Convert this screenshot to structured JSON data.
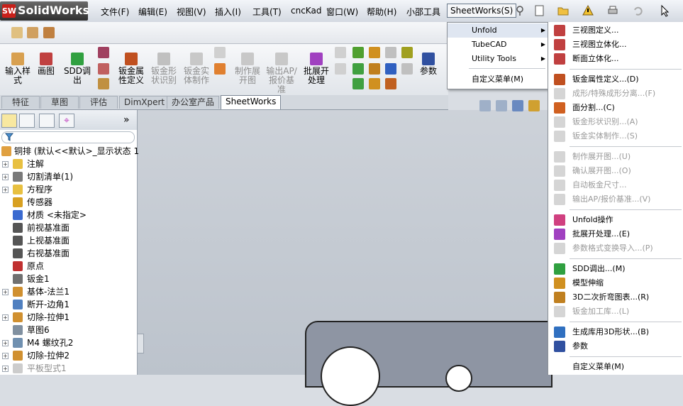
{
  "app": {
    "logo_text": "SolidWorks",
    "logo_badge": "SW"
  },
  "menubar": {
    "items": [
      "文件(F)",
      "编辑(E)",
      "视图(V)",
      "插入(I)",
      "工具(T)",
      "cncKad",
      "窗口(W)",
      "帮助(H)",
      "小邵工具",
      "SheetWorks(S)"
    ]
  },
  "command_manager": {
    "buttons": [
      {
        "label": "输入样\n式",
        "enabled": true
      },
      {
        "label": "画图",
        "enabled": true
      },
      {
        "label": "SDD调出",
        "enabled": true
      },
      {
        "label": "钣金属\n性定义",
        "enabled": true
      },
      {
        "label": "钣金形\n状识别",
        "enabled": false
      },
      {
        "label": "钣金实\n体制作",
        "enabled": false
      },
      {
        "label": "制作展\n开图",
        "enabled": false
      },
      {
        "label": "输出AP/\n报价基\n准",
        "enabled": false
      },
      {
        "label": "批展开\n处理",
        "enabled": true
      },
      {
        "label": "参数",
        "enabled": true
      }
    ]
  },
  "tabs": [
    {
      "label": "特征",
      "active": false
    },
    {
      "label": "草图",
      "active": false
    },
    {
      "label": "评估",
      "active": false
    },
    {
      "label": "DimXpert",
      "active": false
    },
    {
      "label": "办公室产品",
      "active": false
    },
    {
      "label": "SheetWorks",
      "active": true
    }
  ],
  "tree": {
    "root": "铜排 (默认<<默认>_显示状态 1",
    "items": [
      {
        "label": "注解",
        "expand": true,
        "icon": "annotation-icon",
        "color": "#e8c040"
      },
      {
        "label": "切割清单(1)",
        "expand": true,
        "icon": "cut-list-icon",
        "color": "#7a7a7a"
      },
      {
        "label": "方程序",
        "expand": true,
        "icon": "equation-icon",
        "color": "#e8c040"
      },
      {
        "label": "传感器",
        "expand": false,
        "icon": "sensor-icon",
        "color": "#d8a020"
      },
      {
        "label": "材质 <未指定>",
        "expand": false,
        "icon": "material-icon",
        "color": "#3a6ad0"
      },
      {
        "label": "前视基准面",
        "expand": false,
        "icon": "plane-icon",
        "color": "#555"
      },
      {
        "label": "上视基准面",
        "expand": false,
        "icon": "plane-icon",
        "color": "#555"
      },
      {
        "label": "右视基准面",
        "expand": false,
        "icon": "plane-icon",
        "color": "#555"
      },
      {
        "label": "原点",
        "expand": false,
        "icon": "origin-icon",
        "color": "#c03030"
      },
      {
        "label": "钣金1",
        "expand": false,
        "icon": "sheet-metal-icon",
        "color": "#707070"
      },
      {
        "label": "基体-法兰1",
        "expand": true,
        "icon": "base-flange-icon",
        "color": "#d09030"
      },
      {
        "label": "断开-边角1",
        "expand": false,
        "icon": "break-corner-icon",
        "color": "#5080c0"
      },
      {
        "label": "切除-拉伸1",
        "expand": true,
        "icon": "cut-extrude-icon",
        "color": "#d09030"
      },
      {
        "label": "草图6",
        "expand": false,
        "icon": "sketch-icon",
        "color": "#8090a0"
      },
      {
        "label": "M4 螺纹孔2",
        "expand": true,
        "icon": "hole-icon",
        "color": "#7090b0"
      },
      {
        "label": "切除-拉伸2",
        "expand": true,
        "icon": "cut-extrude-icon",
        "color": "#d09030"
      },
      {
        "label": "平板型式1",
        "expand": true,
        "icon": "flat-pattern-icon",
        "color": "#999",
        "disabled": true
      }
    ]
  },
  "submenu": {
    "items": [
      {
        "label": "Unfold",
        "arrow": true,
        "highlighted": true
      },
      {
        "label": "TubeCAD",
        "arrow": true
      },
      {
        "label": "Utility Tools",
        "arrow": true
      },
      {
        "label": "自定义菜单(M)",
        "arrow": false
      }
    ]
  },
  "mainmenu": {
    "items": [
      {
        "label": "三视图定义...",
        "enabled": true,
        "icon": "three-view-icon",
        "color": "#c04040"
      },
      {
        "label": "三视图立体化...",
        "enabled": true,
        "icon": "three-view-solid-icon",
        "color": "#c04040"
      },
      {
        "label": "断面立体化...",
        "enabled": true,
        "icon": "section-solid-icon",
        "color": "#c04040"
      },
      {
        "sep": true
      },
      {
        "label": "钣金属性定义...(D)",
        "enabled": true,
        "icon": "sheet-property-icon",
        "color": "#c05020"
      },
      {
        "label": "成形/特殊成形分离...(F)",
        "enabled": false,
        "icon": "form-split-icon",
        "color": "#888"
      },
      {
        "label": "面分割...(C)",
        "enabled": true,
        "icon": "face-split-icon",
        "color": "#d06020"
      },
      {
        "label": "钣金形状识别...(A)",
        "enabled": false,
        "icon": "shape-recognize-icon",
        "color": "#888"
      },
      {
        "label": "钣金实体制作...(S)",
        "enabled": false,
        "icon": "solid-make-icon",
        "color": "#888"
      },
      {
        "sep": true
      },
      {
        "label": "制作展开图...(U)",
        "enabled": false,
        "icon": "unfold-drawing-icon",
        "color": "#888"
      },
      {
        "label": "确认展开图...(O)",
        "enabled": false,
        "icon": "confirm-unfold-icon",
        "color": "#888"
      },
      {
        "label": "自动板金尺寸...",
        "enabled": false,
        "icon": "auto-dimension-icon",
        "color": "#888"
      },
      {
        "label": "输出AP/报价基准...(V)",
        "enabled": false,
        "icon": "export-ap-icon",
        "color": "#888"
      },
      {
        "sep": true
      },
      {
        "label": "Unfold操作",
        "enabled": true,
        "icon": "unfold-operation-icon",
        "color": "#d04080"
      },
      {
        "label": "批展开处理...(E)",
        "enabled": true,
        "icon": "batch-unfold-icon",
        "color": "#a040c0"
      },
      {
        "label": "参数格式变换导入...(P)",
        "enabled": false,
        "icon": "param-import-icon",
        "color": "#888"
      },
      {
        "sep": true
      },
      {
        "label": "SDD调出...(M)",
        "enabled": true,
        "icon": "sdd-icon",
        "color": "#30a040"
      },
      {
        "label": "模型伸缩",
        "enabled": true,
        "icon": "model-scale-icon",
        "color": "#d09020"
      },
      {
        "label": "3D二次折弯图表...(R)",
        "enabled": true,
        "icon": "bend-table-icon",
        "color": "#c08020"
      },
      {
        "label": "钣金加工库...(L)",
        "enabled": false,
        "icon": "processing-lib-icon",
        "color": "#888"
      },
      {
        "sep": true
      },
      {
        "label": "生成库用3D形状...(B)",
        "enabled": true,
        "icon": "library-shape-icon",
        "color": "#3070c0"
      },
      {
        "label": "参数",
        "enabled": true,
        "icon": "parameter-icon",
        "color": "#3050a0"
      },
      {
        "sep": true
      },
      {
        "label": "自定义菜单(M)",
        "enabled": true,
        "icon": "",
        "color": ""
      }
    ]
  }
}
